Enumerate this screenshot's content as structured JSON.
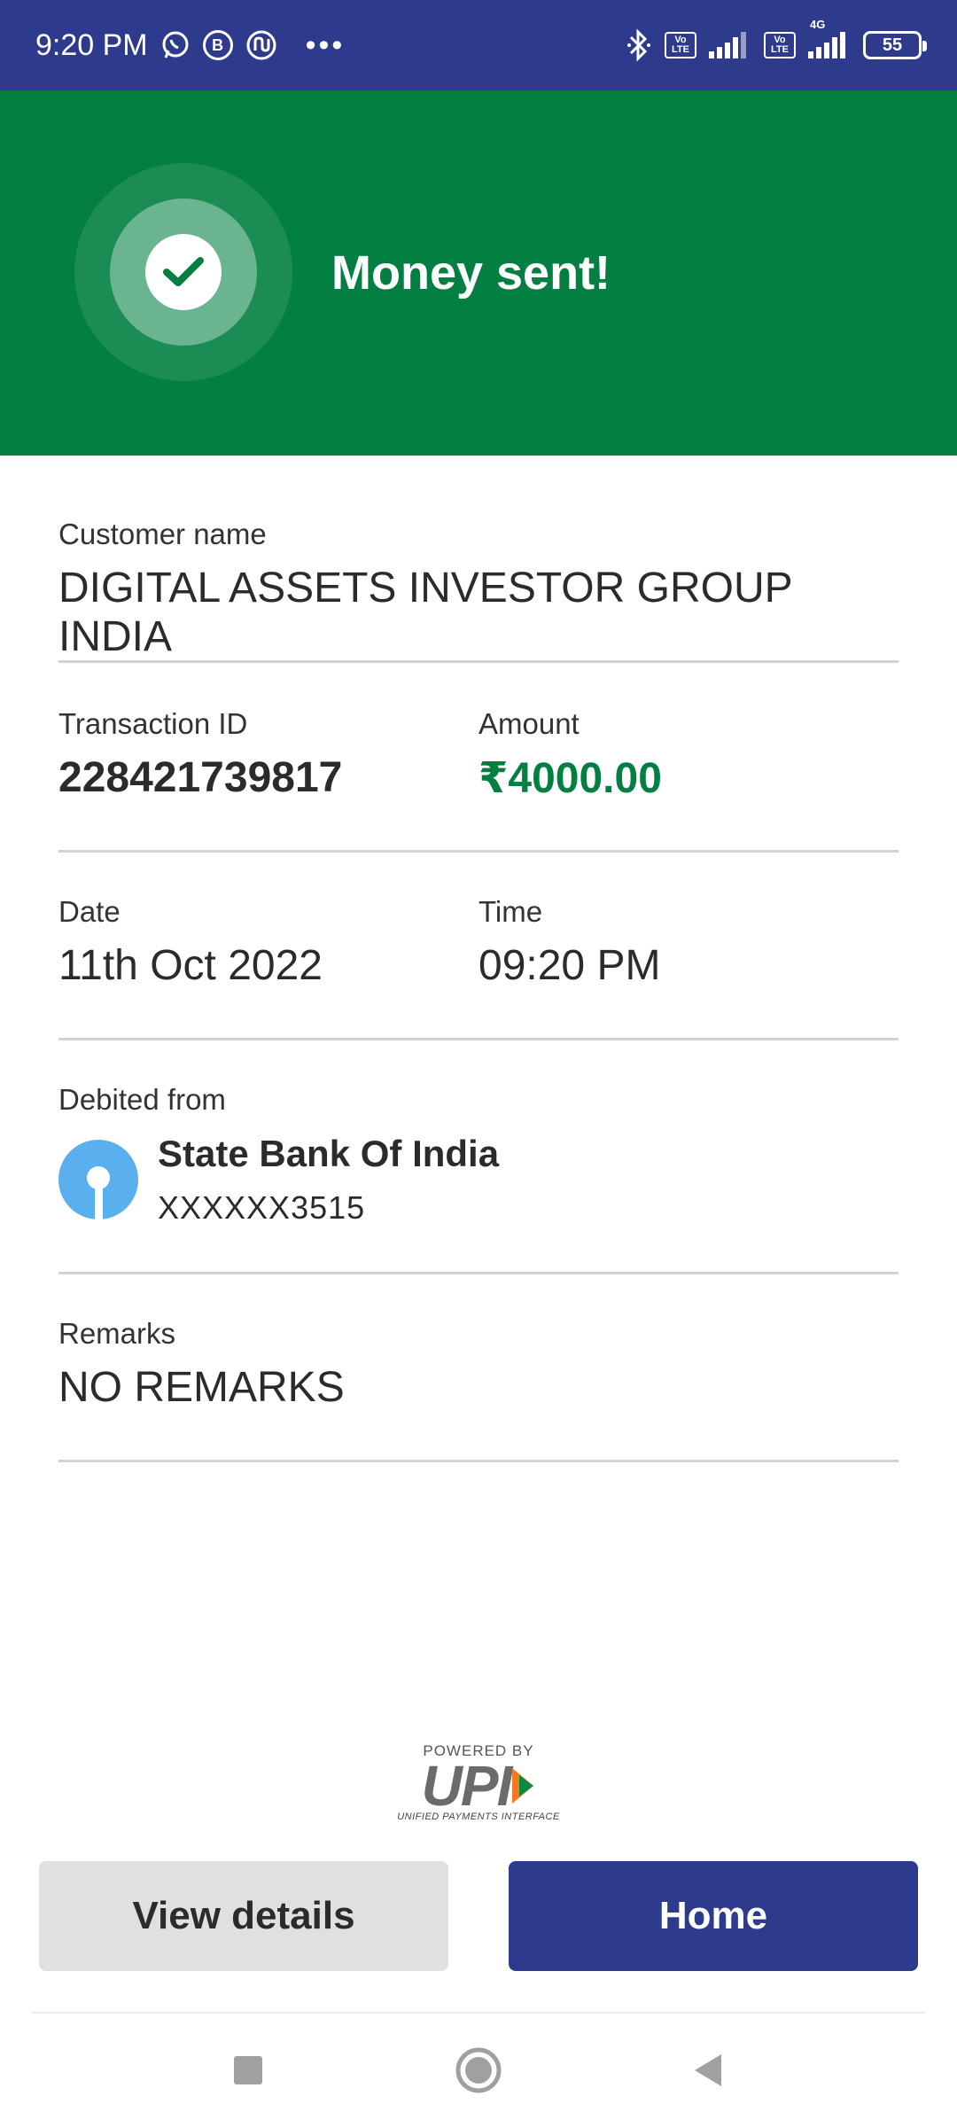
{
  "status_bar": {
    "time": "9:20 PM",
    "icons": [
      "whatsapp-icon",
      "b-icon",
      "app-icon",
      "more-dots-icon",
      "bluetooth-icon",
      "volte-icon",
      "signal-icon",
      "volte-icon",
      "signal-4g-icon",
      "battery-icon"
    ],
    "volte_text": "Vo LTE",
    "network_label": "4G",
    "battery": "55",
    "background_color": "#2e3a8c"
  },
  "header": {
    "title": "Money sent!",
    "background_color": "#037f42",
    "icon": "check-icon"
  },
  "details": {
    "customer": {
      "label": "Customer name",
      "value": "DIGITAL ASSETS INVESTOR GROUP INDIA"
    },
    "transaction": {
      "label": "Transaction ID",
      "value": "228421739817"
    },
    "amount": {
      "label": "Amount",
      "value": "₹4000.00",
      "color": "#037f42"
    },
    "date": {
      "label": "Date",
      "value": "11th Oct 2022"
    },
    "time": {
      "label": "Time",
      "value": "09:20 PM"
    },
    "debit": {
      "label": "Debited from",
      "bank_name": "State Bank Of India",
      "account": "XXXXXX3515",
      "logo_color": "#5ab0ef"
    },
    "remarks": {
      "label": "Remarks",
      "value": "NO REMARKS"
    }
  },
  "footer": {
    "powered_by": "POWERED BY",
    "upi_logo": "UPI",
    "upi_tagline": "UNIFIED PAYMENTS INTERFACE"
  },
  "buttons": {
    "view_details": "View details",
    "home": "Home",
    "home_color": "#2e3a8c"
  },
  "nav": {
    "icons": [
      "recents-icon",
      "home-icon",
      "back-icon"
    ]
  }
}
